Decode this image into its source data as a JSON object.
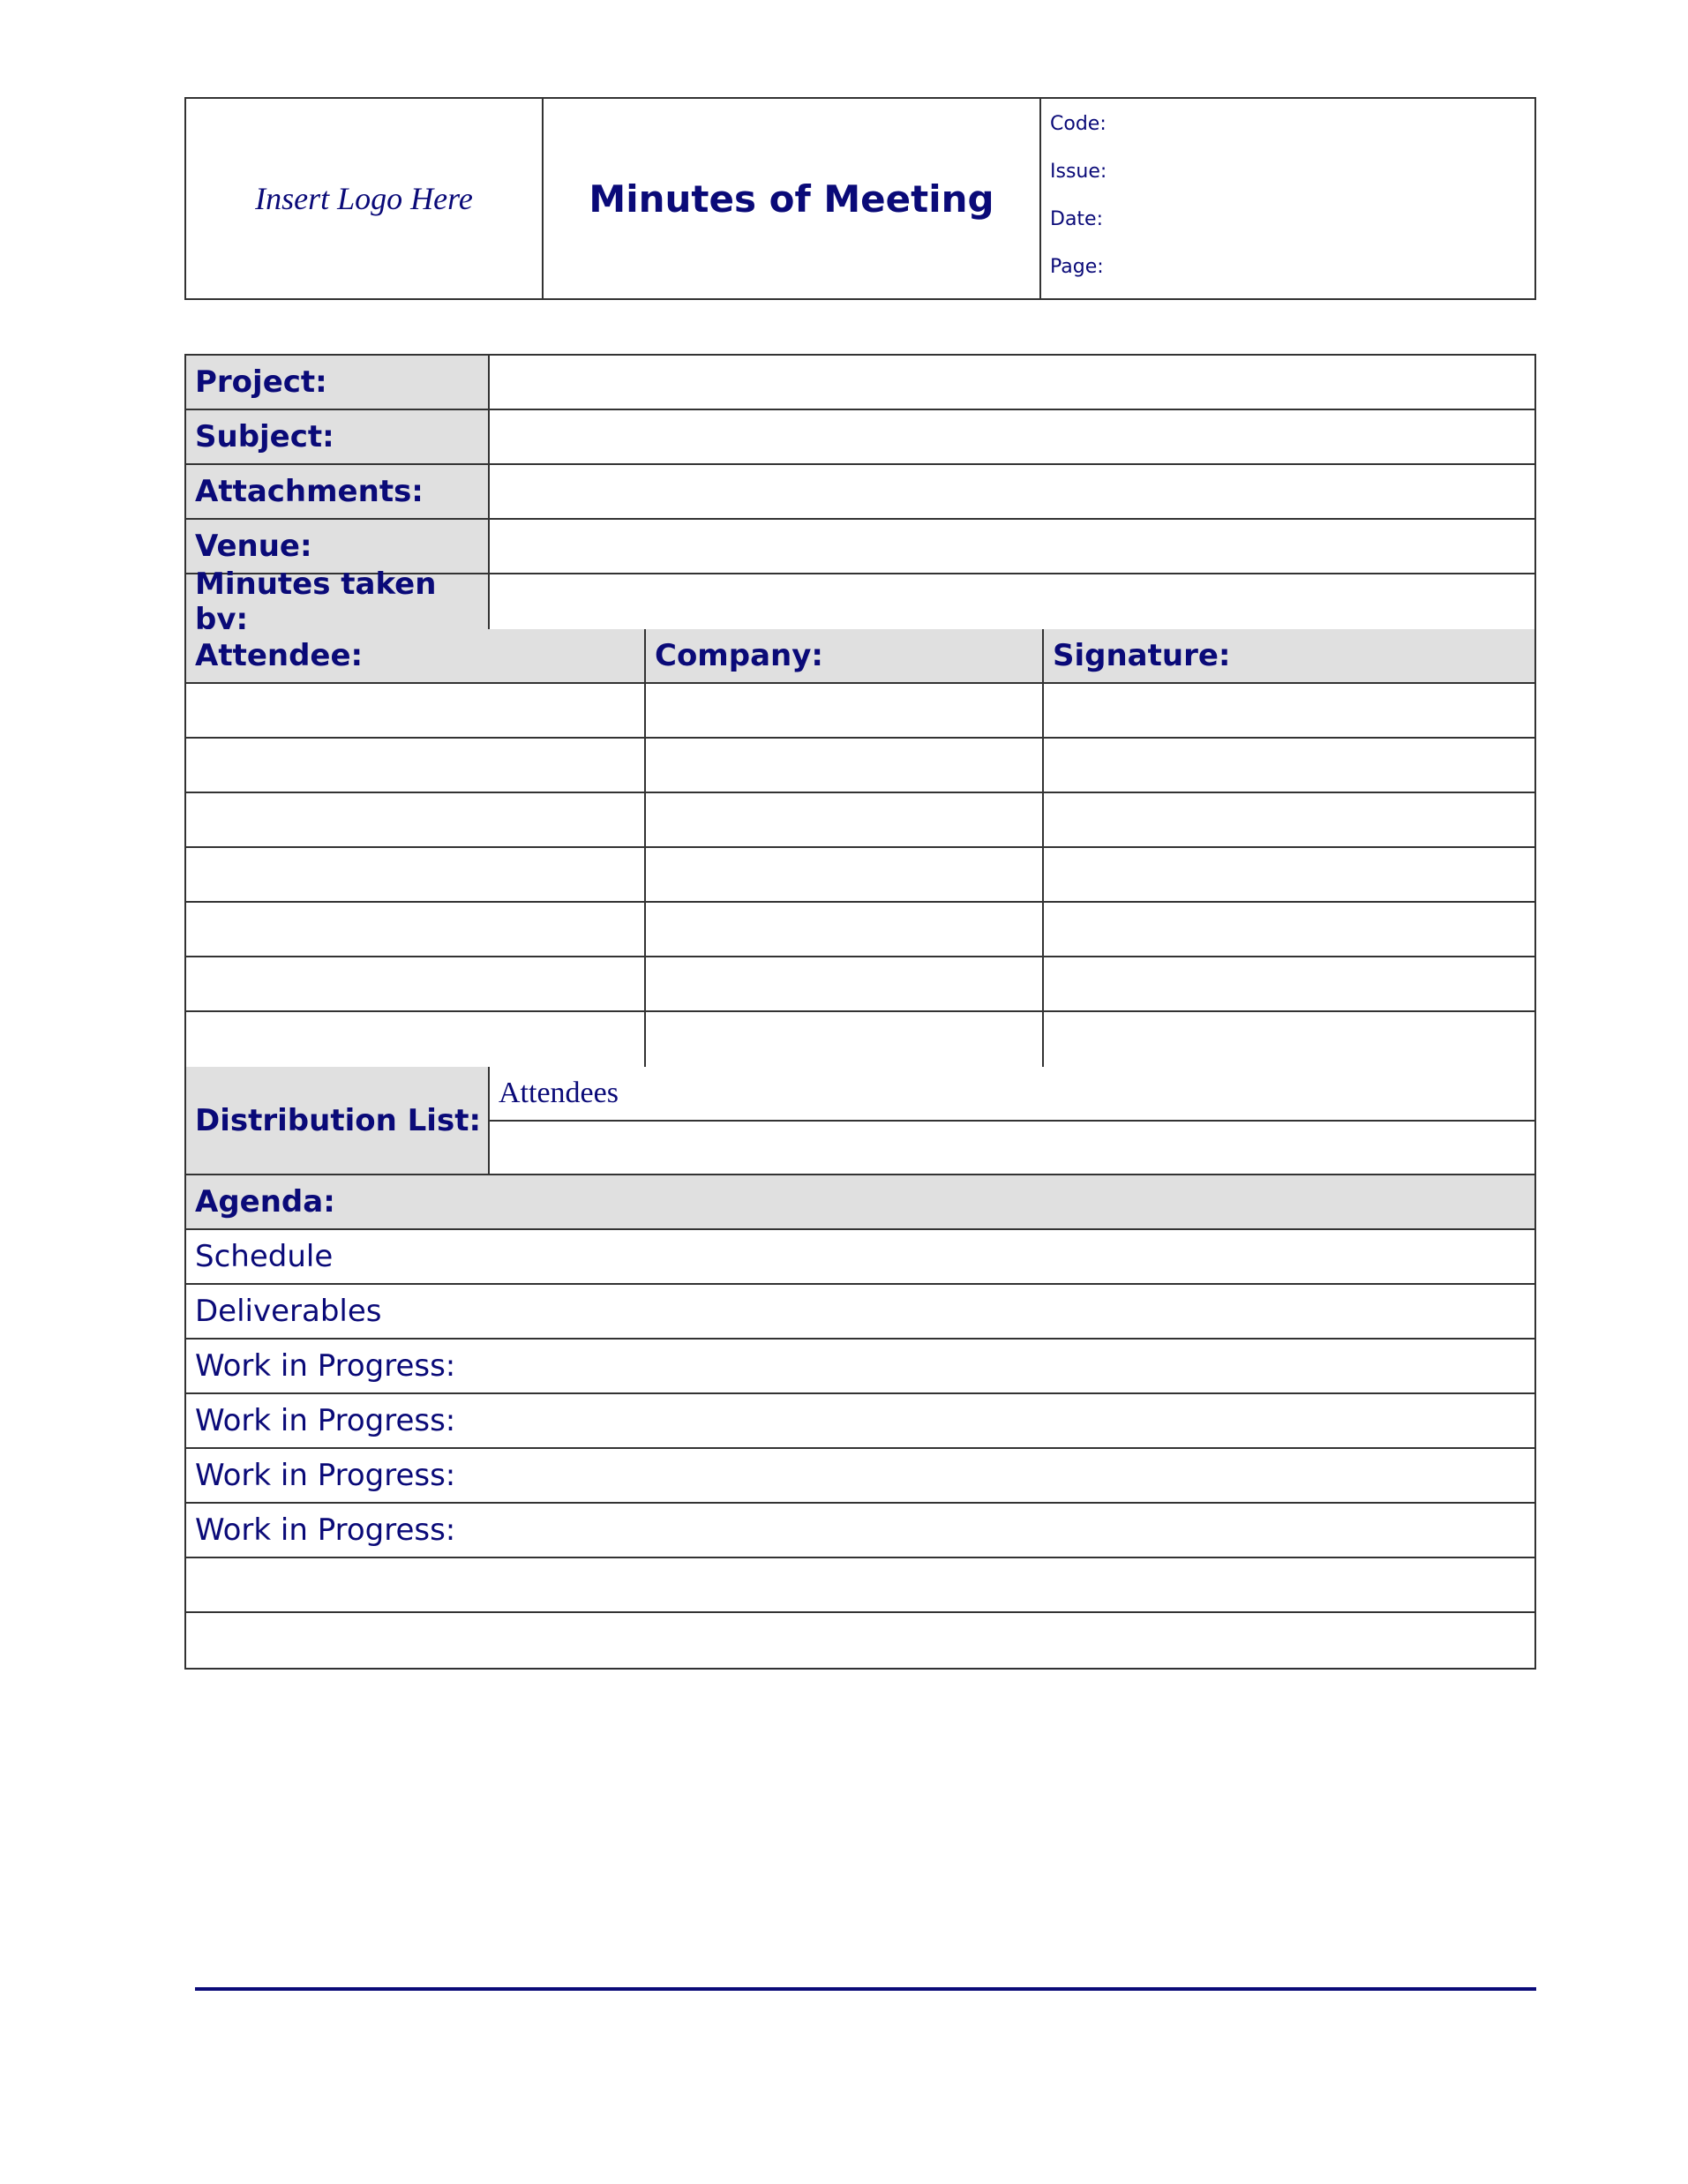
{
  "header": {
    "logo_placeholder": "Insert Logo Here",
    "title": "Minutes of Meeting",
    "meta": [
      "Code:",
      "Issue:",
      "Date:",
      "Page:"
    ]
  },
  "fields": [
    {
      "label": "Project:",
      "value": ""
    },
    {
      "label": "Subject:",
      "value": ""
    },
    {
      "label": "Attachments:",
      "value": ""
    },
    {
      "label": "Venue:",
      "value": ""
    },
    {
      "label": "Minutes taken by:",
      "value": ""
    }
  ],
  "attendees": {
    "columns": [
      "Attendee:",
      "Company:",
      "Signature:"
    ],
    "row_count": 7
  },
  "distribution": {
    "label": "Distribution List:",
    "values": [
      "Attendees",
      ""
    ]
  },
  "agenda": {
    "label": "Agenda:",
    "items": [
      "Schedule",
      "Deliverables",
      "Work in Progress:",
      "Work in Progress:",
      "Work in Progress:",
      "Work in Progress:",
      "",
      ""
    ]
  },
  "colors": {
    "text": "#0a0a78",
    "label_bg": "#e0e0e0",
    "border": "#333333"
  }
}
